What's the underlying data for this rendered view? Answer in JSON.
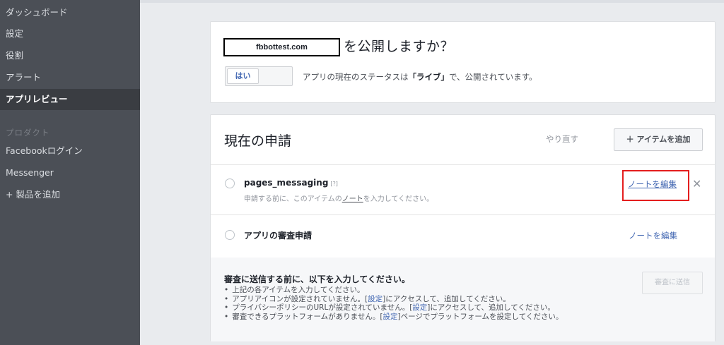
{
  "sidebar": {
    "items": [
      {
        "label": "ダッシュボード"
      },
      {
        "label": "設定"
      },
      {
        "label": "役割"
      },
      {
        "label": "アラート"
      },
      {
        "label": "アプリレビュー"
      }
    ],
    "section_label": "プロダクト",
    "products": [
      {
        "label": "Facebookログイン"
      },
      {
        "label": "Messenger"
      },
      {
        "label": "+ 製品を追加"
      }
    ]
  },
  "publish": {
    "domain": "fbbottest.com",
    "question": "を公開しますか？",
    "toggle_yes": "はい",
    "status_prefix": "アプリの現在のステータスは",
    "status_value": "「ライブ」",
    "status_suffix": "で、公開されています。"
  },
  "requests": {
    "title": "現在の申請",
    "redo_label": "やり直す",
    "add_item_label": "＋ アイテムを追加",
    "rows": [
      {
        "name": "pages_messaging",
        "help": "[?]",
        "sub_prefix": "申請する前に、このアイテムの",
        "sub_link": "ノート",
        "sub_suffix": "を入力してください。",
        "edit_label": "ノートを編集",
        "close_label": "✕"
      },
      {
        "name": "アプリの審査申請",
        "edit_label": "ノートを編集"
      }
    ],
    "submit": {
      "title": "審査に送信する前に、以下を入力してください。",
      "button_label": "審査に送信",
      "requirements": [
        {
          "pre": "上記の各アイテムを入力してください。",
          "link": "",
          "post": ""
        },
        {
          "pre": "アプリアイコンが設定されていません。[",
          "link": "設定",
          "post": "]にアクセスして、追加してください。"
        },
        {
          "pre": "プライバシーポリシーのURLが設定されていません。[",
          "link": "設定",
          "post": "]にアクセスして、追加してください。"
        },
        {
          "pre": "審査できるプラットフォームがありません。[",
          "link": "設定",
          "post": "]ページでプラットフォームを設定してください。"
        }
      ]
    }
  },
  "colors": {
    "sidebar_bg": "#4b4f56",
    "link": "#4267b2",
    "highlight": "#e41e1e"
  }
}
